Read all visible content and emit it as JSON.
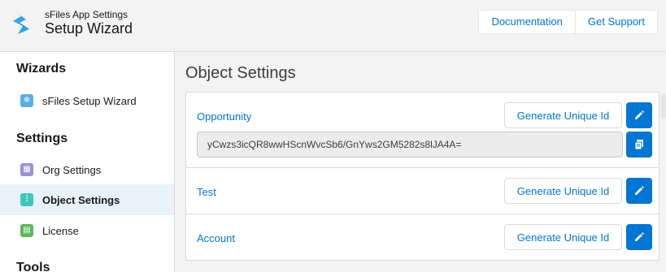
{
  "app": {
    "subtitle": "sFiles App Settings",
    "title": "Setup Wizard",
    "logo_icon": "sfiles-logo-icon"
  },
  "header": {
    "documentation_label": "Documentation",
    "support_label": "Get Support"
  },
  "sidebar": {
    "wizards_heading": "Wizards",
    "settings_heading": "Settings",
    "tools_heading": "Tools",
    "items": [
      {
        "label": "sFiles Setup Wizard",
        "icon": "snowflake-icon",
        "color": "#5aaee8"
      },
      {
        "label": "Org Settings",
        "icon": "grid-icon",
        "color": "#9b8fd6"
      },
      {
        "label": "Object Settings",
        "icon": "sliders-icon",
        "color": "#3fc6bc",
        "active": true
      },
      {
        "label": "License",
        "icon": "document-icon",
        "color": "#5cb85c"
      }
    ]
  },
  "main": {
    "title": "Object Settings",
    "generate_label": "Generate Unique Id",
    "objects": [
      {
        "name": "Opportunity",
        "unique_id": "yCwzs3icQR8wwHScnWvcSb6/GnYws2GM5282s8lJA4A="
      },
      {
        "name": "Test"
      },
      {
        "name": "Account"
      }
    ]
  },
  "colors": {
    "brand": "#0176d3",
    "active_nav": "#e8f2fb",
    "field_bg": "#ececec"
  }
}
